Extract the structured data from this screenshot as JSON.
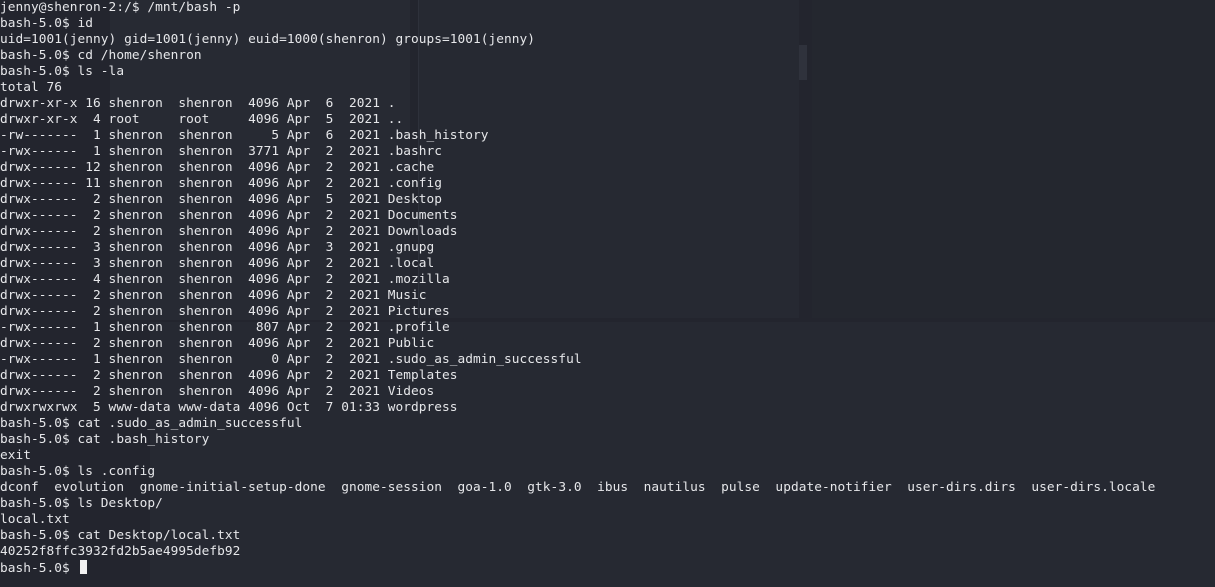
{
  "terminal": {
    "lines": [
      "jenny@shenron-2:/$ /mnt/bash -p",
      "bash-5.0$ id",
      "uid=1001(jenny) gid=1001(jenny) euid=1000(shenron) groups=1001(jenny)",
      "bash-5.0$ cd /home/shenron",
      "bash-5.0$ ls -la",
      "total 76",
      "drwxr-xr-x 16 shenron  shenron  4096 Apr  6  2021 .",
      "drwxr-xr-x  4 root     root     4096 Apr  5  2021 ..",
      "-rw-------  1 shenron  shenron     5 Apr  6  2021 .bash_history",
      "-rwx------  1 shenron  shenron  3771 Apr  2  2021 .bashrc",
      "drwx------ 12 shenron  shenron  4096 Apr  2  2021 .cache",
      "drwx------ 11 shenron  shenron  4096 Apr  2  2021 .config",
      "drwx------  2 shenron  shenron  4096 Apr  5  2021 Desktop",
      "drwx------  2 shenron  shenron  4096 Apr  2  2021 Documents",
      "drwx------  2 shenron  shenron  4096 Apr  2  2021 Downloads",
      "drwx------  3 shenron  shenron  4096 Apr  3  2021 .gnupg",
      "drwx------  3 shenron  shenron  4096 Apr  2  2021 .local",
      "drwx------  4 shenron  shenron  4096 Apr  2  2021 .mozilla",
      "drwx------  2 shenron  shenron  4096 Apr  2  2021 Music",
      "drwx------  2 shenron  shenron  4096 Apr  2  2021 Pictures",
      "-rwx------  1 shenron  shenron   807 Apr  2  2021 .profile",
      "drwx------  2 shenron  shenron  4096 Apr  2  2021 Public",
      "-rwx------  1 shenron  shenron     0 Apr  2  2021 .sudo_as_admin_successful",
      "drwx------  2 shenron  shenron  4096 Apr  2  2021 Templates",
      "drwx------  2 shenron  shenron  4096 Apr  2  2021 Videos",
      "drwxrwxrwx  5 www-data www-data 4096 Oct  7 01:33 wordpress",
      "bash-5.0$ cat .sudo_as_admin_successful",
      "bash-5.0$ cat .bash_history",
      "exit",
      "bash-5.0$ ls .config",
      "dconf  evolution  gnome-initial-setup-done  gnome-session  goa-1.0  gtk-3.0  ibus  nautilus  pulse  update-notifier  user-dirs.dirs  user-dirs.locale",
      "bash-5.0$ ls Desktop/",
      "local.txt",
      "bash-5.0$ cat Desktop/local.txt",
      "40252f8ffc3932fd2b5ae4995defb92",
      "bash-5.0$ "
    ]
  },
  "colors": {
    "background": "#23252e",
    "foreground": "#e6e7ea",
    "cursor": "#f2f2f2"
  }
}
